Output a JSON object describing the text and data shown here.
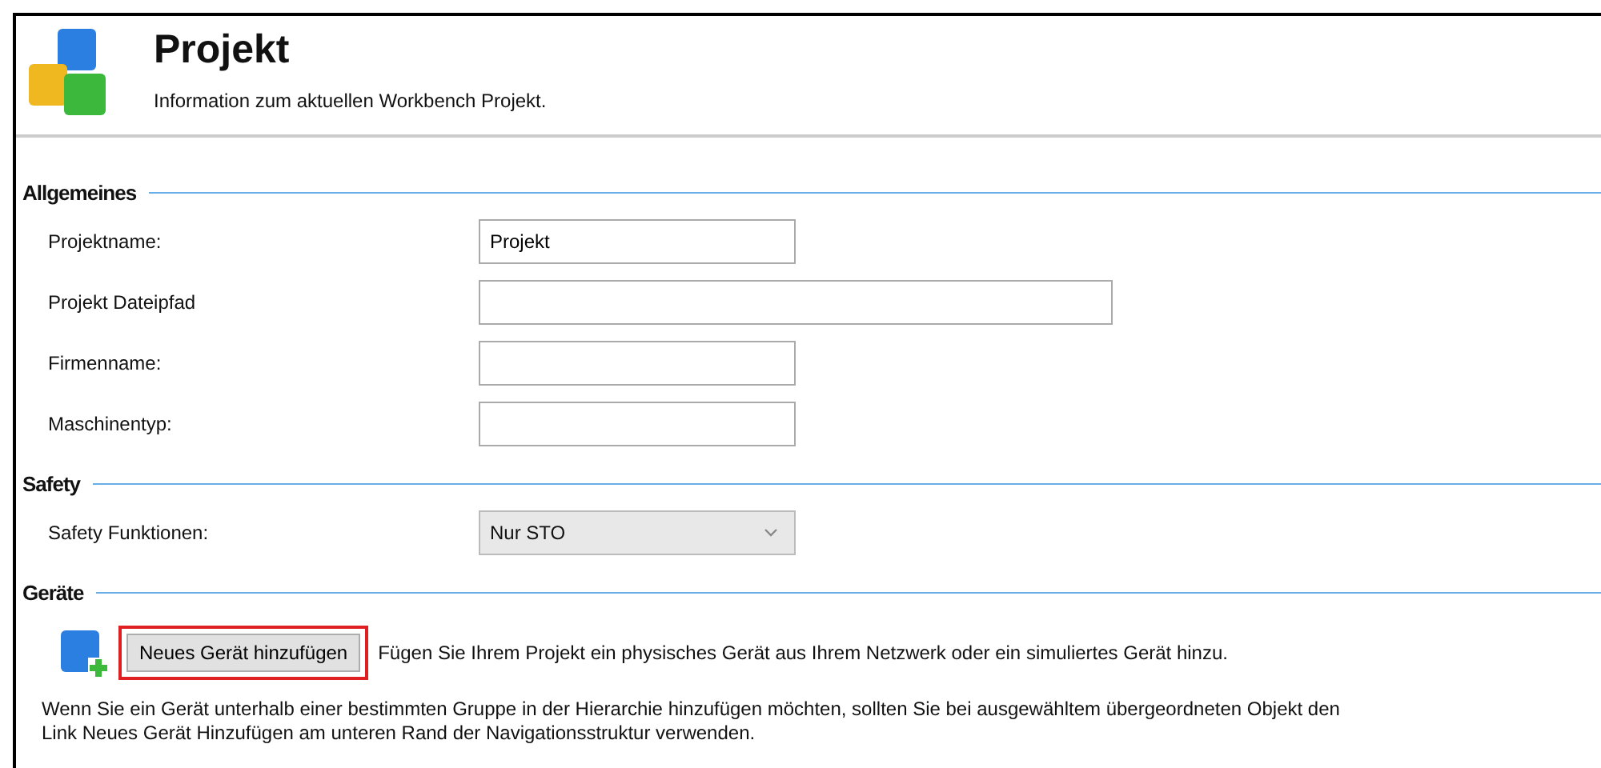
{
  "header": {
    "title": "Projekt",
    "subtitle": "Information zum aktuellen Workbench Projekt."
  },
  "sections": [
    {
      "title": "Allgemeines",
      "fields": [
        {
          "kind": "text",
          "label": "Projektname:",
          "value": "Projekt"
        },
        {
          "kind": "wide_text",
          "label": "Projekt Dateipfad"
        },
        {
          "kind": "text",
          "label": "Firmenname:"
        },
        {
          "kind": "text",
          "label": "Maschinentyp:"
        }
      ]
    },
    {
      "title": "Safety",
      "fields": [
        {
          "kind": "dropdown",
          "label": "Safety Funktionen:",
          "value": "Nur STO"
        }
      ]
    },
    {
      "title": "Geräte"
    }
  ],
  "devices": {
    "button": "Neues Gerät hinzufügen",
    "highlighted": true,
    "description": "Fügen Sie Ihrem Projekt ein physisches Gerät aus Ihrem Netzwerk oder ein simuliertes Gerät hinzu.",
    "note_lines": [
      "Wenn Sie ein Gerät unterhalb einer bestimmten Gruppe in der Hierarchie hinzufügen möchten, sollten Sie bei ausgewähltem übergeordneten Objekt den",
      "Link Neues Gerät Hinzufügen am unteren Rand der Navigationsstruktur verwenden."
    ]
  }
}
